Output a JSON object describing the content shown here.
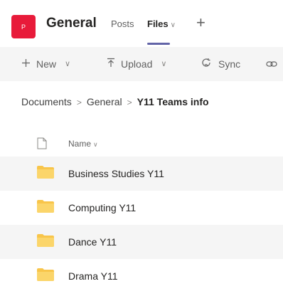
{
  "header": {
    "avatar_letter": "P",
    "team_name": "General",
    "tabs": [
      {
        "label": "Posts"
      },
      {
        "label": "Files"
      }
    ],
    "add_tab_label": "+"
  },
  "toolbar": {
    "new_label": "New",
    "upload_label": "Upload",
    "sync_label": "Sync"
  },
  "breadcrumb": {
    "items": [
      "Documents",
      "General",
      "Y11 Teams info"
    ]
  },
  "list": {
    "name_header": "Name",
    "rows": [
      {
        "name": "Business Studies Y11"
      },
      {
        "name": "Computing Y11"
      },
      {
        "name": "Dance Y11"
      },
      {
        "name": "Drama Y11"
      }
    ]
  },
  "colors": {
    "avatar": "#e81b3a",
    "accent": "#6264a7",
    "folder": "#f8c54a",
    "toolbar_bg": "#f5f5f5"
  },
  "icons": [
    "plus-icon",
    "upload-icon",
    "sync-icon",
    "link-icon",
    "chevron-down-icon",
    "chevron-right-icon",
    "document-icon",
    "folder-icon"
  ]
}
